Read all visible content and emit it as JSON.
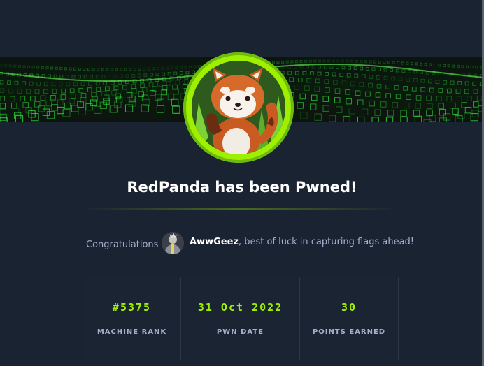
{
  "header": {
    "title": "RedPanda has been Pwned!",
    "machine_avatar_icon": "red-panda-icon"
  },
  "congrats": {
    "label": "Congratulations",
    "username": "AwwGeez",
    "message": ", best of luck in capturing flags ahead!"
  },
  "stats": [
    {
      "value": "#5375",
      "label": "MACHINE RANK"
    },
    {
      "value": "31 Oct 2022",
      "label": "PWN DATE"
    },
    {
      "value": "30",
      "label": "POINTS EARNED"
    }
  ],
  "colors": {
    "accent": "#9fef00",
    "background": "#1a2332",
    "muted_text": "#a4b1cd"
  }
}
